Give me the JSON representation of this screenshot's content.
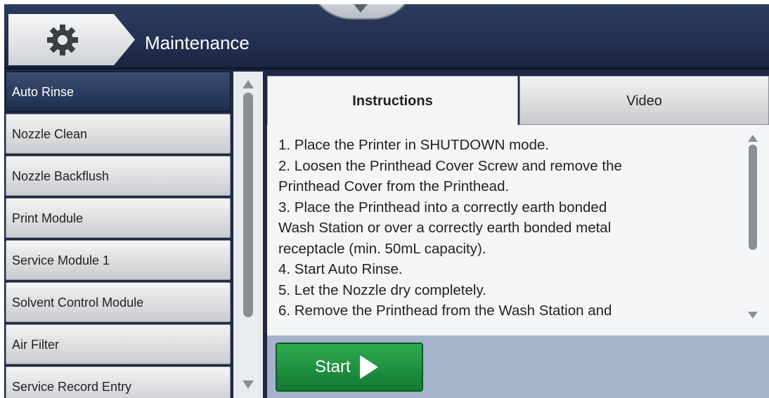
{
  "header": {
    "title": "Maintenance",
    "settings_icon": "gear-icon",
    "dropdown_icon": "chevron-down-icon"
  },
  "sidebar": {
    "items": [
      {
        "label": "Auto Rinse",
        "selected": true
      },
      {
        "label": "Nozzle Clean"
      },
      {
        "label": "Nozzle Backflush"
      },
      {
        "label": "Print Module"
      },
      {
        "label": "Service Module 1"
      },
      {
        "label": "Solvent Control Module"
      },
      {
        "label": "Air Filter"
      },
      {
        "label": "Service Record Entry"
      }
    ]
  },
  "tabs": [
    {
      "label": "Instructions",
      "active": true
    },
    {
      "label": "Video"
    }
  ],
  "instructions": {
    "lines": [
      "1. Place the Printer in SHUTDOWN mode.",
      "2. Loosen the  Printhead Cover Screw and remove the",
      "Printhead Cover from the Printhead.",
      "3. Place the Printhead into a correctly earth bonded",
      "Wash Station or over a correctly earth bonded metal",
      "receptacle (min. 50mL capacity).",
      "4. Start Auto Rinse.",
      "5. Let the Nozzle dry completely.",
      "6. Remove the Printhead from the Wash Station and"
    ]
  },
  "actions": {
    "start_label": "Start",
    "start_icon": "play-icon"
  },
  "colors": {
    "header": "#233253",
    "selected_item": "#2c3c5e",
    "start_button": "#1f8f3e",
    "bottom_bar": "#a4b3cc"
  }
}
